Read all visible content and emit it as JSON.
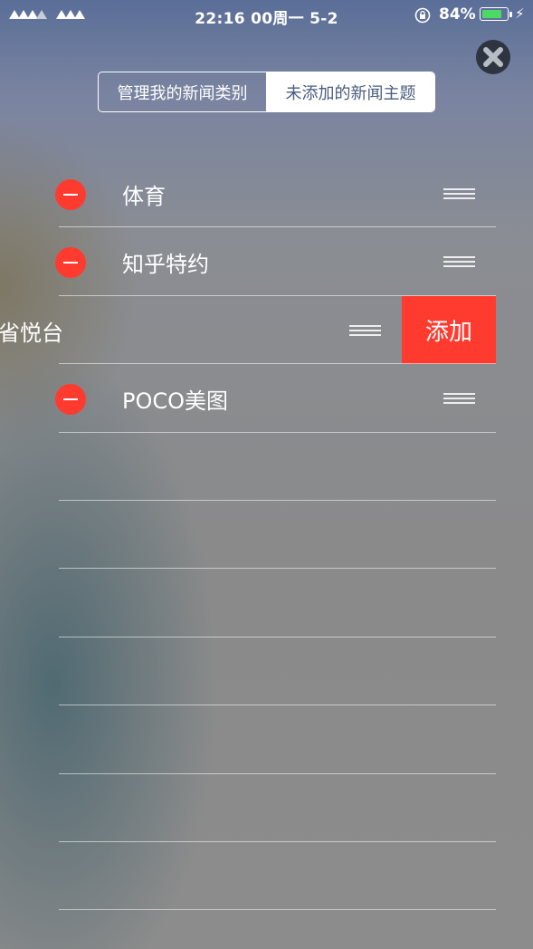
{
  "status_bar": {
    "time": "22:16 00周一 5-2",
    "battery_percent": "84%",
    "battery_level": 0.84,
    "bolt": "⚡"
  },
  "header": {
    "close_icon": "close-circle-icon",
    "tabs": [
      {
        "label": "管理我的新闻类别",
        "active": true
      },
      {
        "label": "未添加的新闻主题",
        "active": false
      }
    ]
  },
  "list": {
    "items": [
      {
        "label": "体育"
      },
      {
        "label": "知乎特约"
      },
      {
        "label": "省悦台",
        "swiped": true,
        "action_label": "添加"
      },
      {
        "label": "POCO美图"
      }
    ],
    "empty_rows": 7
  },
  "colors": {
    "delete_red": "#ff3b30",
    "battery_green": "#4cd964"
  }
}
